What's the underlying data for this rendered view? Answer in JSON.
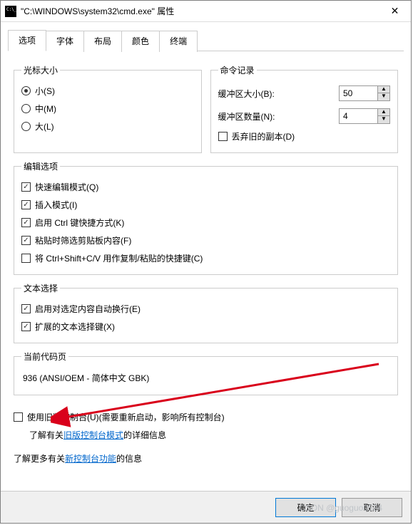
{
  "window": {
    "title": "\"C:\\WINDOWS\\system32\\cmd.exe\" 属性"
  },
  "tabs": {
    "options": "选项",
    "font": "字体",
    "layout": "布局",
    "colors": "颜色",
    "terminal": "终端"
  },
  "cursor": {
    "legend": "光标大小",
    "small": "小(S)",
    "medium": "中(M)",
    "large": "大(L)"
  },
  "history": {
    "legend": "命令记录",
    "buffer_size_label": "缓冲区大小(B):",
    "buffer_size_value": "50",
    "buffer_count_label": "缓冲区数量(N):",
    "buffer_count_value": "4",
    "discard_label": "丢弃旧的副本(D)"
  },
  "edit": {
    "legend": "编辑选项",
    "quick_edit": "快速编辑模式(Q)",
    "insert_mode": "插入模式(I)",
    "ctrl_shortcuts": "启用 Ctrl 键快捷方式(K)",
    "filter_clipboard": "粘贴时筛选剪贴板内容(F)",
    "ctrl_shift_cv": "将 Ctrl+Shift+C/V 用作复制/粘贴的快捷键(C)"
  },
  "text_select": {
    "legend": "文本选择",
    "line_wrap": "启用对选定内容自动换行(E)",
    "extended_keys": "扩展的文本选择键(X)"
  },
  "codepage": {
    "legend": "当前代码页",
    "value": "936   (ANSI/OEM - 简体中文 GBK)"
  },
  "legacy": {
    "checkbox_label": "使用旧版控制台(U)(需要重新启动，影响所有控制台)",
    "learn_prefix": "了解有关",
    "learn_link": "旧版控制台模式",
    "learn_suffix": "的详细信息"
  },
  "more_info": {
    "prefix": "了解更多有关",
    "link": "新控制台功能",
    "suffix": "的信息"
  },
  "buttons": {
    "ok": "确定",
    "cancel": "取消"
  },
  "watermark": "CSDN @guoguo0524"
}
